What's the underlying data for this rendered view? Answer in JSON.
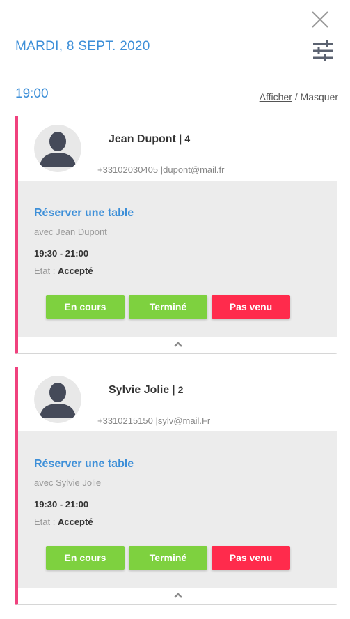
{
  "header": {
    "date": "MARDI, 8 SEPT. 2020"
  },
  "timeslot": {
    "time": "19:00",
    "show_label": "Afficher",
    "separator": " / ",
    "hide_label": "Masquer"
  },
  "reservations": [
    {
      "name": "Jean Dupont",
      "separator": "|",
      "guests": "4",
      "phone": "+33102030405",
      "contact_separator": "|",
      "email": "dupont@mail.fr",
      "title": "Réserver une table",
      "with": "avec Jean Dupont",
      "time_range": "19:30 - 21:00",
      "state_label": "Etat : ",
      "state_value": "Accepté",
      "btn_in_progress": "En cours",
      "btn_done": "Terminé",
      "btn_no_show": "Pas venu"
    },
    {
      "name": "Sylvie Jolie",
      "separator": "|",
      "guests": "2",
      "phone": "+3310215150",
      "contact_separator": "|",
      "email": "sylv@mail.Fr",
      "title": "Réserver une table",
      "with": "avec Sylvie Jolie",
      "time_range": "19:30 - 21:00",
      "state_label": "Etat : ",
      "state_value": "Accepté",
      "btn_in_progress": "En cours",
      "btn_done": "Terminé",
      "btn_no_show": "Pas venu"
    }
  ],
  "colors": {
    "accent_blue": "#3d8fd8",
    "card_border_pink": "#f0417e",
    "btn_green": "#7ed13f",
    "btn_red": "#ff2b4c"
  }
}
